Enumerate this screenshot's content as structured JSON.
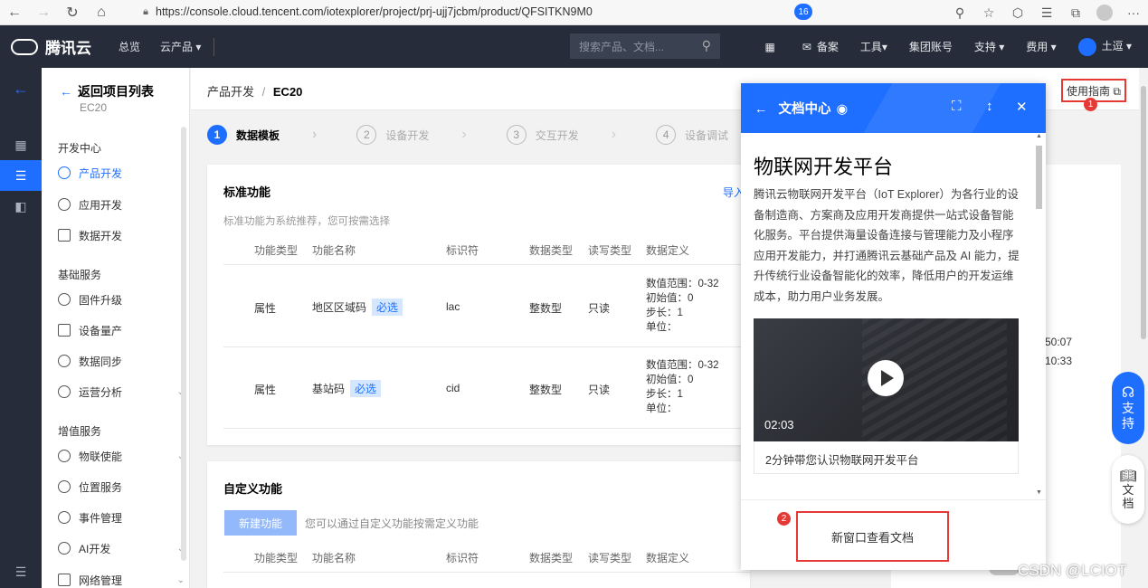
{
  "browser": {
    "url": "https://console.cloud.tencent.com/iotexplorer/project/prj-ujj7jcbm/product/QFSITKN9M0"
  },
  "topnav": {
    "brand": "腾讯云",
    "overview": "总览",
    "products": "云产品 ▾",
    "search_placeholder": "搜索产品、文档...",
    "mail_badge": "16",
    "beian": "备案",
    "tools": "工具▾",
    "group_account": "集团账号",
    "support": "支持 ▾",
    "billing": "费用 ▾",
    "user": "土逗 ▾"
  },
  "sidebar": {
    "back_label": "返回项目列表",
    "project": "EC20",
    "groups": [
      {
        "title": "开发中心",
        "items": [
          "产品开发",
          "应用开发",
          "数据开发"
        ]
      },
      {
        "title": "基础服务",
        "items": [
          "固件升级",
          "设备量产",
          "数据同步",
          "运营分析"
        ]
      },
      {
        "title": "增值服务",
        "items": [
          "物联使能",
          "位置服务",
          "事件管理",
          "AI开发",
          "网络管理"
        ]
      }
    ]
  },
  "main": {
    "crumb_parent": "产品开发",
    "crumb_sep": "/",
    "crumb_current": "EC20",
    "guide_button": "使用指南 ⧉",
    "steps": [
      {
        "num": "1",
        "label": "数据模板"
      },
      {
        "num": "2",
        "label": "设备开发"
      },
      {
        "num": "3",
        "label": "交互开发"
      },
      {
        "num": "4",
        "label": "设备调试"
      }
    ],
    "standard": {
      "title": "标准功能",
      "subtitle": "标准功能为系统推荐，您可按需选择",
      "import_link": "导入",
      "columns": [
        "功能类型",
        "功能名称",
        "标识符",
        "数据类型",
        "读写类型",
        "数据定义"
      ],
      "rows": [
        {
          "type": "属性",
          "name": "地区区域码",
          "tag": "必选",
          "id": "lac",
          "dtype": "整数型",
          "rw": "只读",
          "def": [
            "数值范围：0-32",
            "初始值：0",
            "步长：1",
            "单位："
          ]
        },
        {
          "type": "属性",
          "name": "基站码",
          "tag": "必选",
          "id": "cid",
          "dtype": "整数型",
          "rw": "只读",
          "def": [
            "数值范围：0-32",
            "初始值：0",
            "步长：1",
            "单位："
          ]
        }
      ]
    },
    "custom": {
      "title": "自定义功能",
      "new_button": "新建功能",
      "hint": "您可以通过自定义功能按需定义功能",
      "columns": [
        "功能类型",
        "功能名称",
        "标识符",
        "数据类型",
        "读写类型",
        "数据定义"
      ]
    },
    "right_times": [
      "50:07",
      "10:33"
    ]
  },
  "doc_panel": {
    "title": "文档中心",
    "heading": "物联网开发平台",
    "paragraph": "腾讯云物联网开发平台（IoT Explorer）为各行业的设备制造商、方案商及应用开发商提供一站式设备智能化服务。平台提供海量设备连接与管理能力及小程序应用开发能力，并打通腾讯云基础产品及 AI 能力，提升传统行业设备智能化的效率，降低用户的开发运维成本，助力用户业务发展。",
    "video_duration": "02:03",
    "video_caption": "2分钟带您认识物联网开发平台",
    "open_new_window": "新窗口查看文档"
  },
  "floating": {
    "support": [
      "支",
      "持"
    ],
    "docs": [
      "文",
      "档"
    ]
  },
  "annotations": {
    "one": "1",
    "two": "2"
  },
  "watermark": "CSDN @LCIOT",
  "colors": {
    "accent": "#1e6fff",
    "nav_bg": "#262c3a",
    "highlight": "#e53935"
  }
}
